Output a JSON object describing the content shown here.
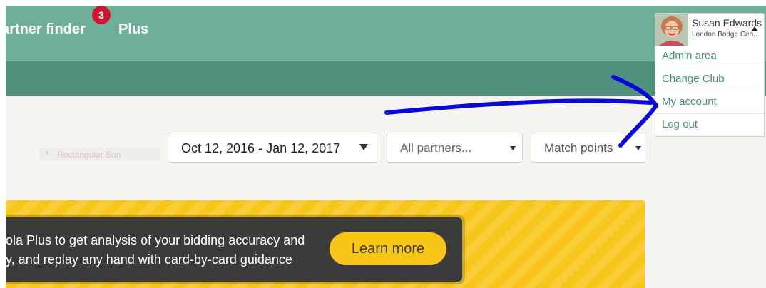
{
  "nav": {
    "partner_finder": "artner finder",
    "badge_count": "3",
    "plus": "Plus"
  },
  "user": {
    "name": "Susan Edwards",
    "club": "London Bridge Cen..."
  },
  "user_menu": {
    "items": [
      {
        "label": "Admin area"
      },
      {
        "label": "Change Club"
      },
      {
        "label": "My account"
      },
      {
        "label": "Log out"
      }
    ]
  },
  "filters": {
    "faded_tag": "Rectangular Sun",
    "date_range": "Oct 12, 2016 - Jan 12, 2017",
    "partners": "All partners...",
    "scoring": "Match points"
  },
  "promo": {
    "line1": "nola Plus to get analysis of your bidding accuracy and",
    "line2": "ay, and replay any hand with card-by-card guidance",
    "button": "Learn more"
  },
  "colors": {
    "nav_bg": "#6fb09b",
    "subnav_bg": "#4f917d",
    "link": "#4a8f79",
    "badge": "#d0152f",
    "promo_yellow": "#f7c619",
    "promo_dark": "#3b3b3b",
    "annotation_arrow": "#0a0ad8"
  }
}
